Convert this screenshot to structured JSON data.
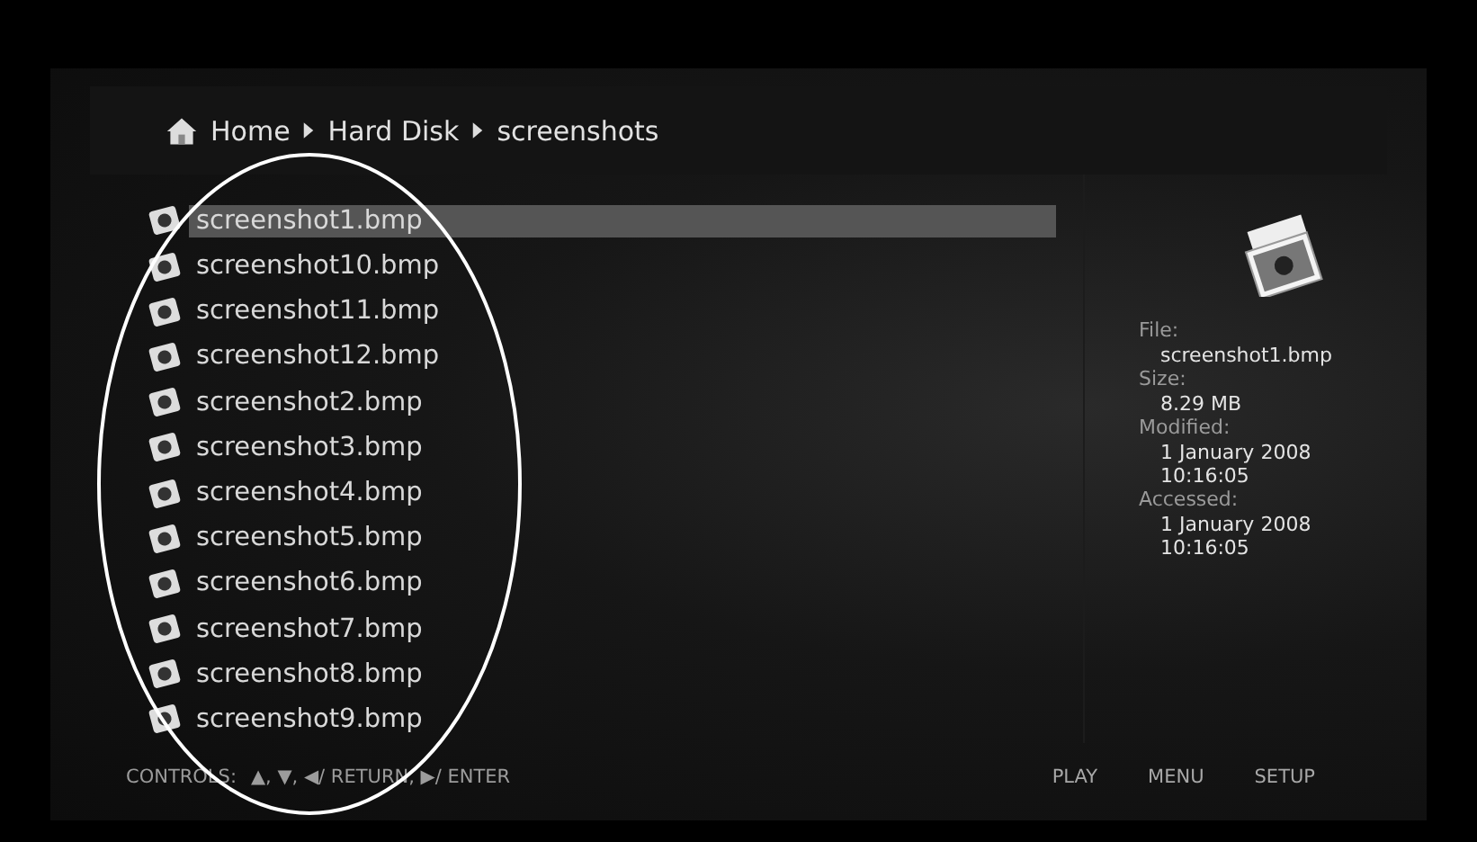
{
  "breadcrumb": [
    {
      "label": "Home",
      "kind": "home"
    },
    {
      "label": "Hard Disk",
      "kind": "folder"
    },
    {
      "label": "screenshots",
      "kind": "folder"
    }
  ],
  "files": [
    {
      "name": "screenshot1.bmp",
      "selected": true
    },
    {
      "name": "screenshot10.bmp",
      "selected": false
    },
    {
      "name": "screenshot11.bmp",
      "selected": false
    },
    {
      "name": "screenshot12.bmp",
      "selected": false
    },
    {
      "name": "screenshot2.bmp",
      "selected": false
    },
    {
      "name": "screenshot3.bmp",
      "selected": false
    },
    {
      "name": "screenshot4.bmp",
      "selected": false
    },
    {
      "name": "screenshot5.bmp",
      "selected": false
    },
    {
      "name": "screenshot6.bmp",
      "selected": false
    },
    {
      "name": "screenshot7.bmp",
      "selected": false
    },
    {
      "name": "screenshot8.bmp",
      "selected": false
    },
    {
      "name": "screenshot9.bmp",
      "selected": false
    }
  ],
  "details": [
    {
      "label": "File:",
      "values": [
        "screenshot1.bmp"
      ]
    },
    {
      "label": "Size:",
      "values": [
        "8.29 MB"
      ]
    },
    {
      "label": "Modified:",
      "values": [
        "1 January 2008",
        "10:16:05"
      ]
    },
    {
      "label": "Accessed:",
      "values": [
        "1 January 2008",
        "10:16:05"
      ]
    }
  ],
  "footer": {
    "controls_label": "CONTROLS:",
    "controls": "▲, ▼, ◀/ RETURN, ▶/ ENTER",
    "buttons": [
      "PLAY",
      "MENU",
      "SETUP"
    ]
  }
}
